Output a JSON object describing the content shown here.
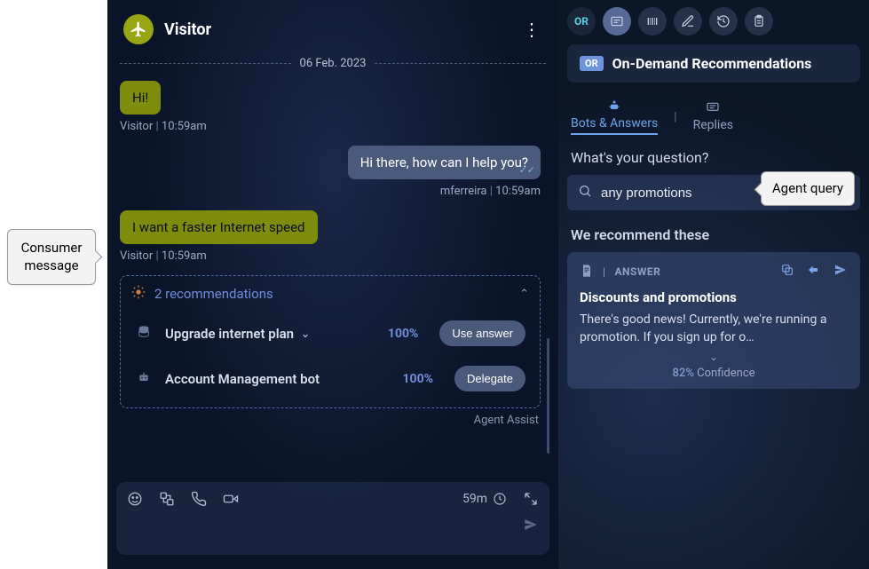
{
  "callouts": {
    "consumer": "Consumer message",
    "agent_query": "Agent query"
  },
  "chat": {
    "title": "Visitor",
    "date": "06 Feb. 2023",
    "messages": [
      {
        "side": "in",
        "text": "Hi!",
        "sender": "Visitor",
        "time": "10:59am"
      },
      {
        "side": "out",
        "text": "Hi there, how can I help you?",
        "sender": "mferreira",
        "time": "10:59am"
      },
      {
        "side": "in",
        "text": "I want a faster Internet speed",
        "sender": "Visitor",
        "time": "10:59am"
      }
    ],
    "recs": {
      "count_label": "2 recommendations",
      "rows": [
        {
          "name": "Upgrade internet plan",
          "pct": "100%",
          "action": "Use answer",
          "has_chevron": true
        },
        {
          "name": "Account Management bot",
          "pct": "100%",
          "action": "Delegate",
          "has_chevron": false
        }
      ],
      "footer": "Agent Assist"
    },
    "composer": {
      "timer": "59m"
    }
  },
  "right": {
    "toolbar_or": "OR",
    "odr": {
      "badge": "OR",
      "title": "On-Demand Recommendations",
      "tabs": {
        "bots": "Bots & Answers",
        "replies": "Replies"
      },
      "question_label": "What's your question?",
      "query": "any promotions",
      "recommend_label": "We recommend these",
      "answer": {
        "type_label": "ANSWER",
        "title": "Discounts and promotions",
        "body": "There's good news! Currently, we're running a promotion. If you sign up for o…",
        "confidence_pct": "82%",
        "confidence_word": "Confidence"
      }
    }
  }
}
